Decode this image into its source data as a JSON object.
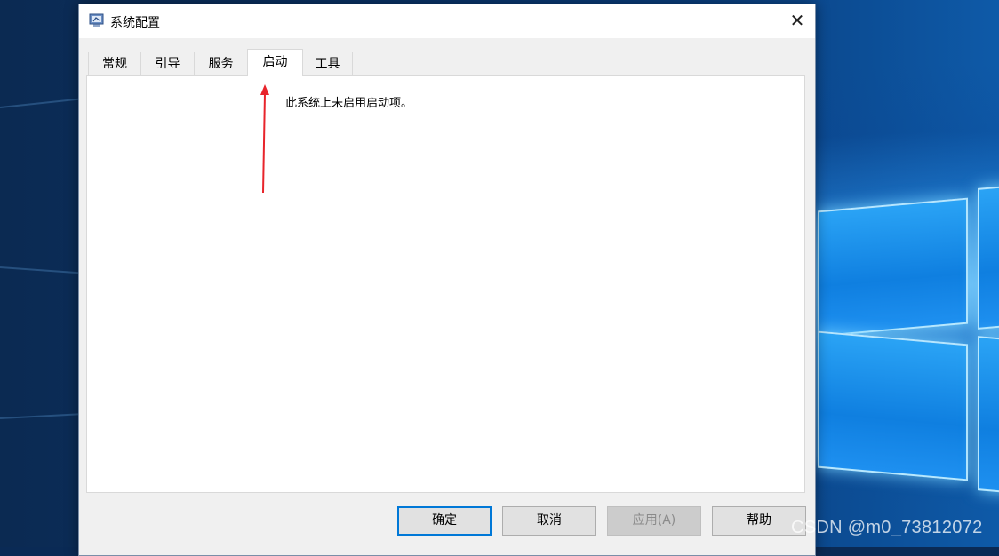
{
  "window": {
    "title": "系统配置",
    "close_glyph": "✕"
  },
  "tabs": [
    {
      "label": "常规"
    },
    {
      "label": "引导"
    },
    {
      "label": "服务"
    },
    {
      "label": "启动",
      "active": true
    },
    {
      "label": "工具"
    }
  ],
  "panel": {
    "message": "此系统上未启用启动项。"
  },
  "buttons": {
    "ok": "确定",
    "cancel": "取消",
    "apply": "应用(A)",
    "help": "帮助"
  },
  "annotation": {
    "arrow_color": "#e8242b"
  },
  "watermark": "CSDN @m0_73812072",
  "colors": {
    "accent": "#0078d7",
    "panel_bg": "#ffffff",
    "window_bg": "#f0f0f0"
  }
}
